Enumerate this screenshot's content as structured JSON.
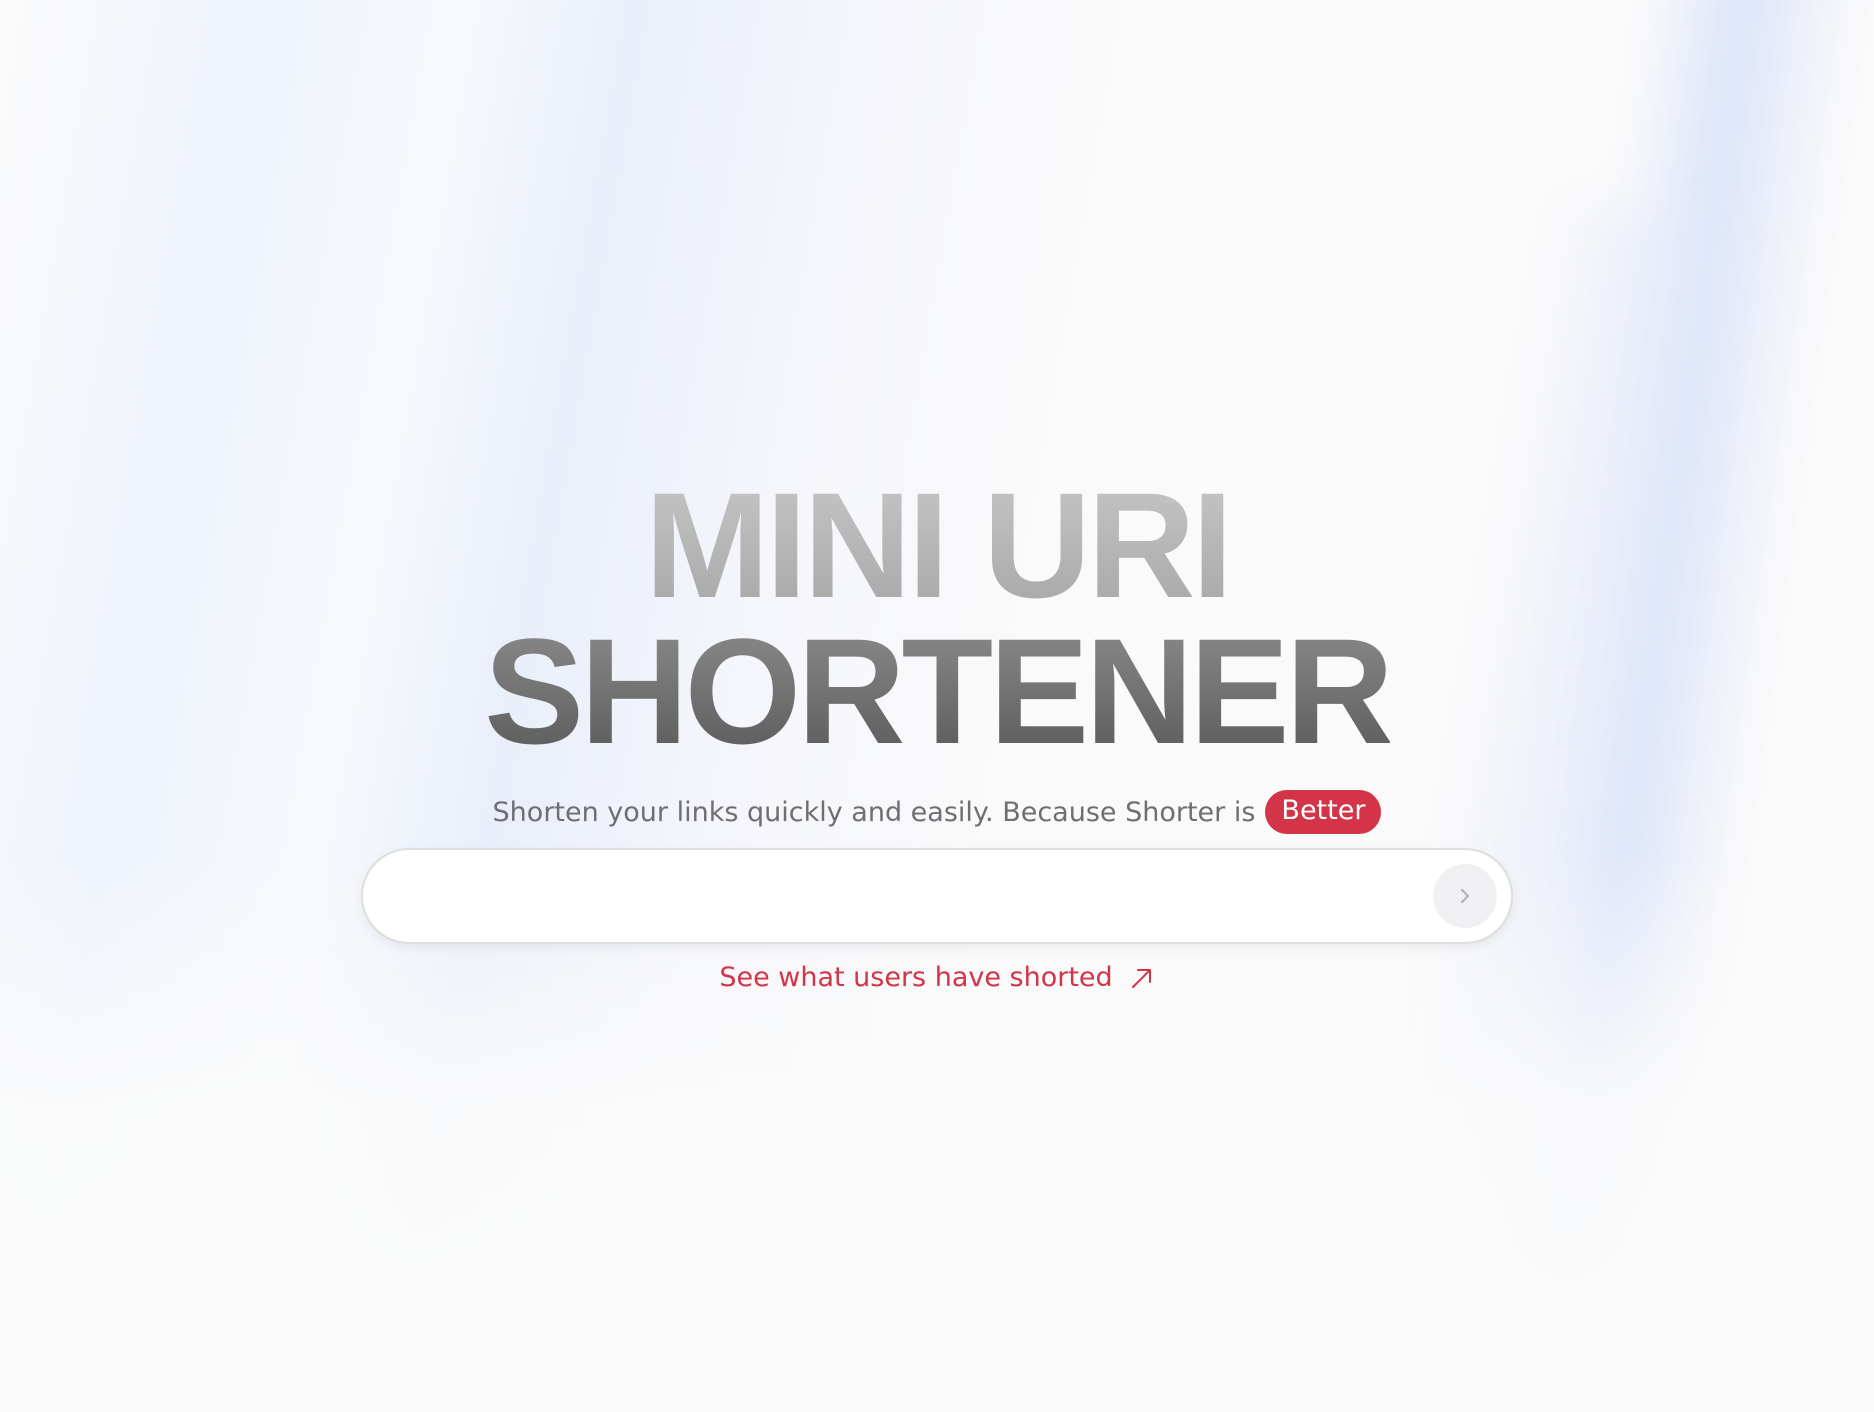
{
  "hero": {
    "title_line_1": "MINI URI",
    "title_line_2": "SHORTENER",
    "subtitle": "Shorten your links quickly and easily. Because Shorter is",
    "badge": "Better"
  },
  "search": {
    "placeholder": "",
    "value": "",
    "submit_icon": "chevron-right-icon"
  },
  "link": {
    "label": "See what users have shorted",
    "icon": "arrow-up-right-icon"
  },
  "colors": {
    "accent": "#d33448",
    "background": "#fafafa",
    "subtitle_text": "#6e6e73"
  }
}
